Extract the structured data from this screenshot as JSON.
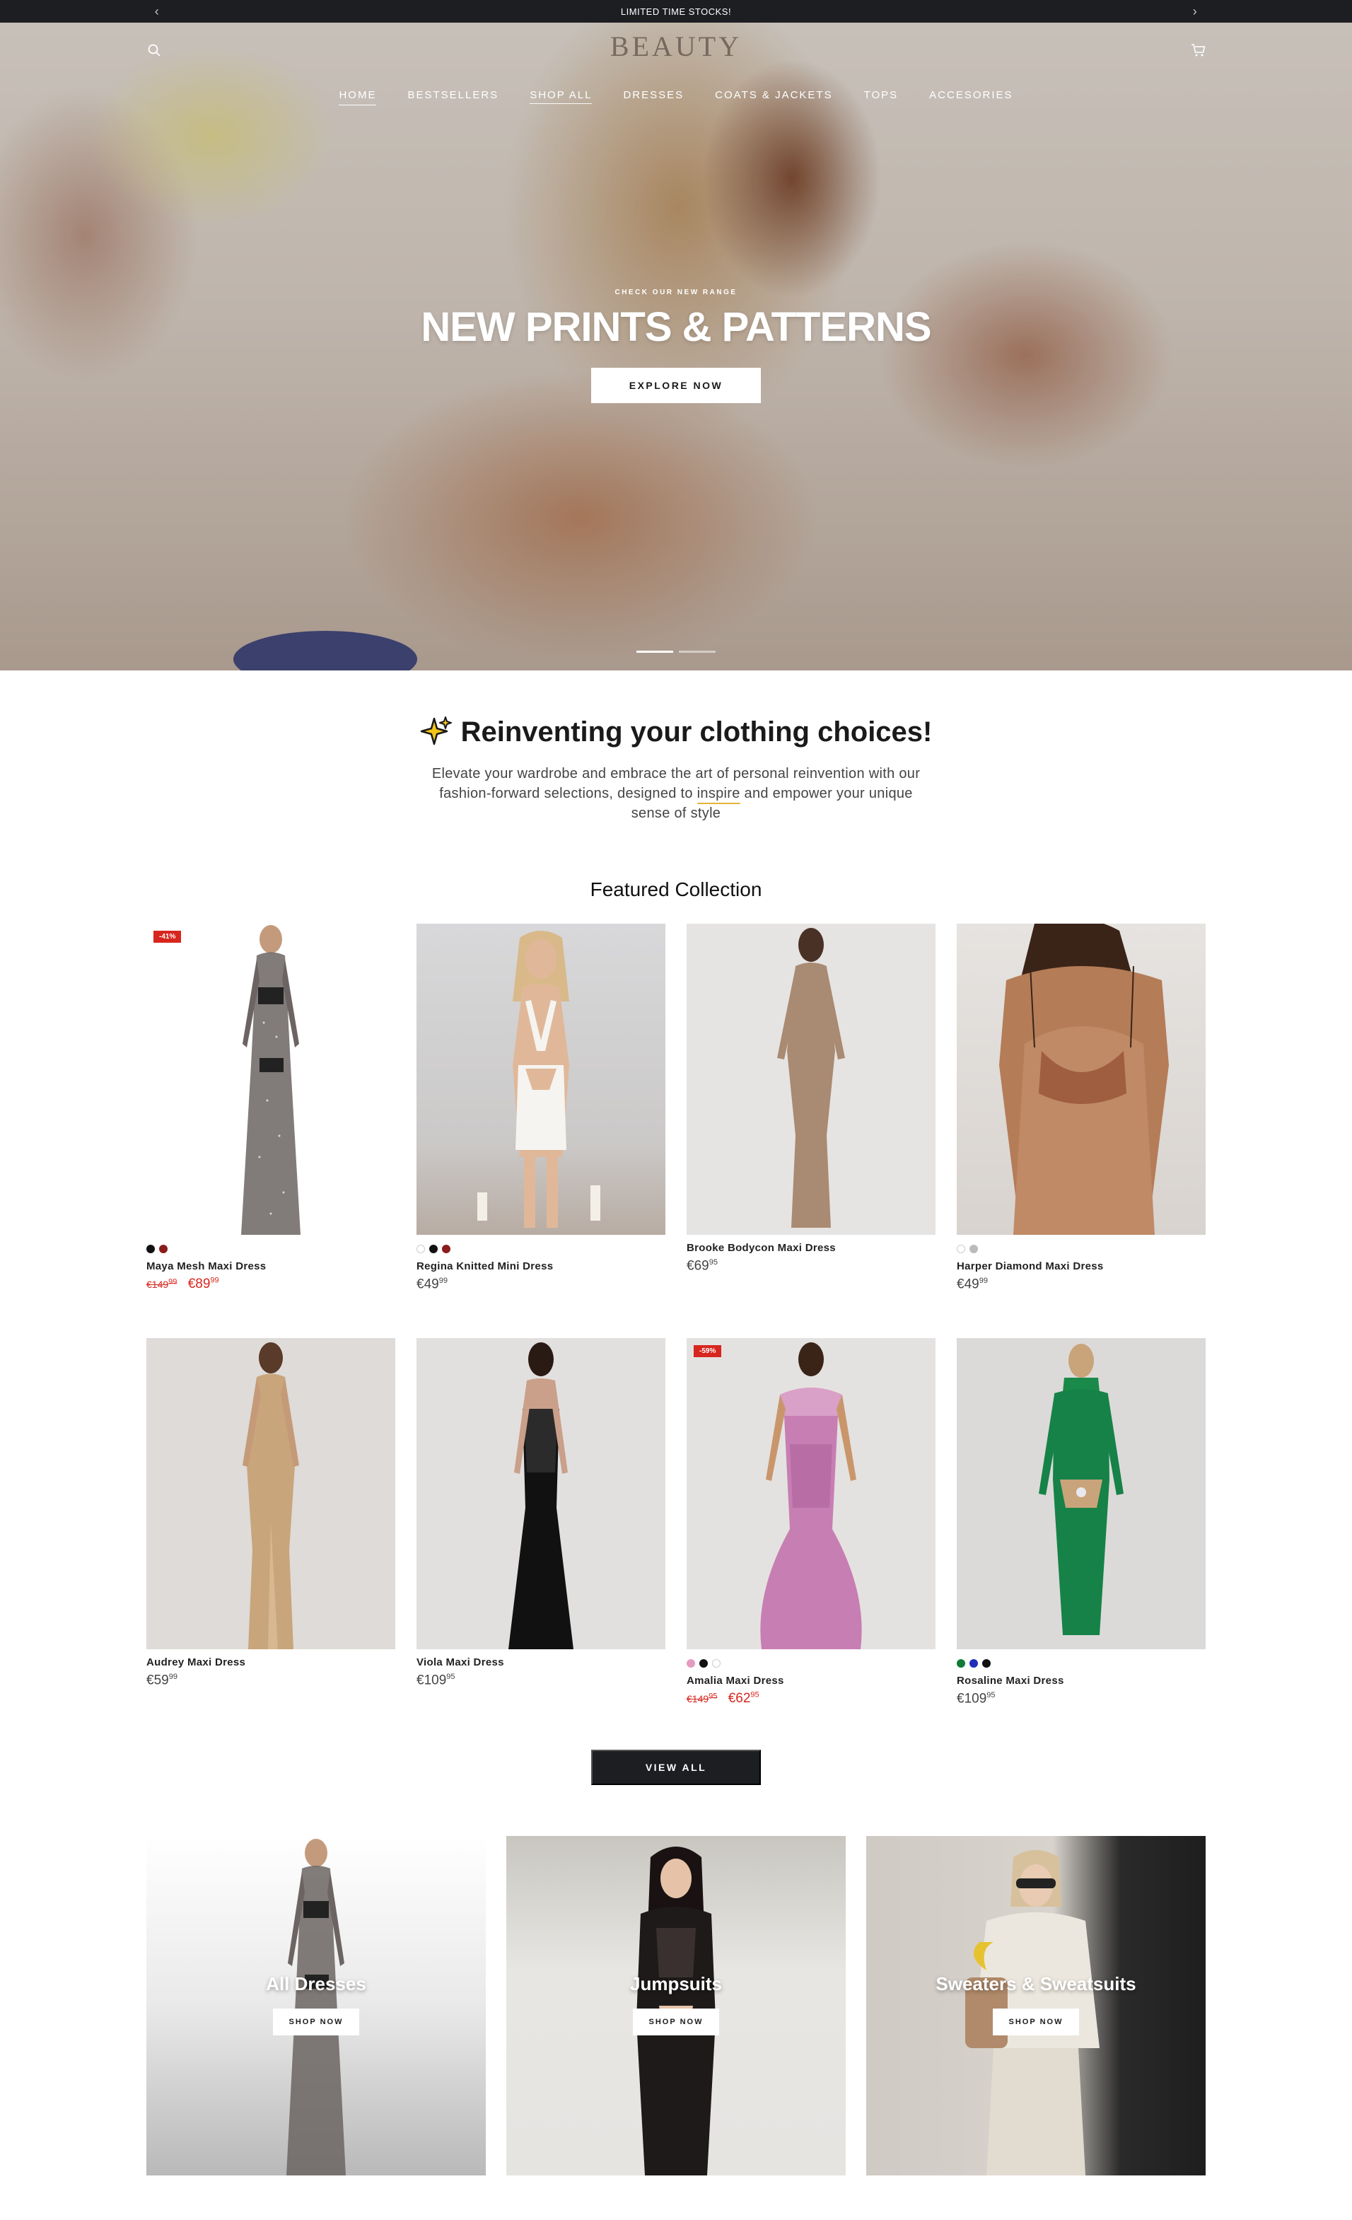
{
  "announcement": {
    "text": "LIMITED TIME STOCKS!",
    "prev_icon": "chevron-left-icon",
    "next_icon": "chevron-right-icon"
  },
  "header": {
    "logo": "BEAUTY",
    "nav": [
      "HOME",
      "BESTSELLERS",
      "SHOP ALL",
      "DRESSES",
      "COATS & JACKETS",
      "TOPS",
      "ACCESORIES"
    ],
    "active_nav": "HOME"
  },
  "hero": {
    "eyebrow": "CHECK OUR NEW RANGE",
    "title": "NEW PRINTS & PATTERNS",
    "button": "EXPLORE NOW",
    "slides": 2,
    "current_slide": 1
  },
  "intro": {
    "heading": "Reinventing your clothing choices!",
    "body_before": "Elevate your wardrobe and embrace the art of personal reinvention with our fashion-forward selections, designed to ",
    "body_highlight": "inspire",
    "body_after": " and empower your unique sense of style"
  },
  "featured": {
    "title": "Featured Collection",
    "products": [
      {
        "name": "Maya Mesh Maxi Dress",
        "badge": "-41%",
        "old_price": "€149",
        "old_cents": "99",
        "price": "€89",
        "cents": "99",
        "sale": true,
        "swatches": [
          "#111111",
          "#8a1c1c"
        ]
      },
      {
        "name": "Regina Knitted Mini Dress",
        "badge": "",
        "price": "€49",
        "cents": "99",
        "sale": false,
        "swatches": [
          "#ffffff",
          "#111111",
          "#8a1c1c"
        ]
      },
      {
        "name": "Brooke Bodycon Maxi Dress",
        "badge": "",
        "price": "€69",
        "cents": "95",
        "sale": false,
        "swatches": []
      },
      {
        "name": "Harper Diamond Maxi Dress",
        "badge": "",
        "price": "€49",
        "cents": "99",
        "sale": false,
        "swatches": [
          "#ffffff",
          "#bbbbbb"
        ]
      },
      {
        "name": "Audrey Maxi Dress",
        "badge": "",
        "price": "€59",
        "cents": "99",
        "sale": false,
        "swatches": []
      },
      {
        "name": "Viola Maxi Dress",
        "badge": "",
        "price": "€109",
        "cents": "95",
        "sale": false,
        "swatches": []
      },
      {
        "name": "Amalia Maxi Dress",
        "badge": "-59%",
        "old_price": "€149",
        "old_cents": "95",
        "price": "€62",
        "cents": "95",
        "sale": true,
        "swatches": [
          "#e59ac2",
          "#111111",
          "#ffffff"
        ]
      },
      {
        "name": "Rosaline Maxi Dress",
        "badge": "",
        "price": "€109",
        "cents": "95",
        "sale": false,
        "swatches": [
          "#137a36",
          "#1f2fb8",
          "#111111"
        ]
      }
    ],
    "view_all": "VIEW ALL"
  },
  "categories": [
    {
      "label": "All Dresses",
      "button": "SHOP NOW"
    },
    {
      "label": "Jumpsuits",
      "button": "SHOP NOW"
    },
    {
      "label": "Sweaters & Sweatsuits",
      "button": "SHOP NOW"
    }
  ],
  "colors": {
    "dark": "#1d1e22",
    "sale_red": "#d7261e",
    "highlight": "#e4b43a"
  }
}
